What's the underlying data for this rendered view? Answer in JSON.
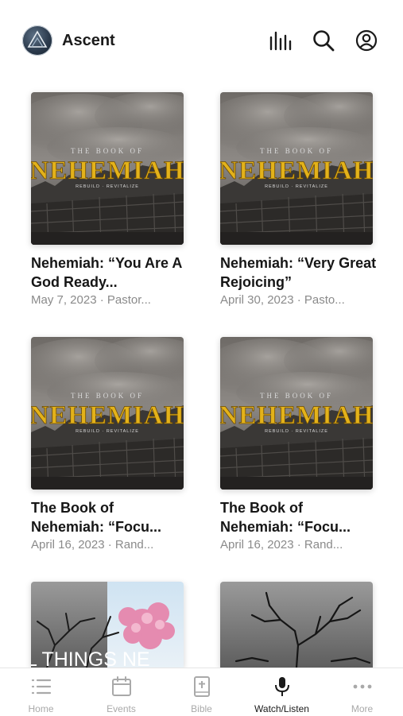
{
  "header": {
    "app_title": "Ascent",
    "icons": [
      "logo-icon",
      "audio-bars-icon",
      "search-icon",
      "account-icon"
    ]
  },
  "cards": [
    {
      "title": "Nehemiah: “You Are A God Ready...",
      "meta": "May 7, 2023 · Pastor...",
      "art_kicker": "THE BOOK OF",
      "art_title": "NEHEMIAH",
      "art_tagline": "REBUILD · REVITALIZE"
    },
    {
      "title": "Nehemiah: “Very Great Rejoicing”",
      "meta": "April 30, 2023 · Pasto...",
      "art_kicker": "THE BOOK OF",
      "art_title": "NEHEMIAH",
      "art_tagline": "REBUILD · REVITALIZE"
    },
    {
      "title": "The Book of Nehemiah: “Focu...",
      "meta": "April 16, 2023 · Rand...",
      "art_kicker": "THE BOOK OF",
      "art_title": "NEHEMIAH",
      "art_tagline": "REBUILD · REVITALIZE"
    },
    {
      "title": "The Book of Nehemiah: “Focu...",
      "meta": "April 16, 2023 · Rand...",
      "art_kicker": "THE BOOK OF",
      "art_title": "NEHEMIAH",
      "art_tagline": "REBUILD · REVITALIZE"
    }
  ],
  "partial_cards": [
    {
      "art_text": "L THINGS NE"
    },
    {
      "art_text": ""
    }
  ],
  "tabbar": {
    "items": [
      {
        "label": "Home",
        "icon": "list-icon",
        "active": false
      },
      {
        "label": "Events",
        "icon": "calendar-icon",
        "active": false
      },
      {
        "label": "Bible",
        "icon": "bible-icon",
        "active": false
      },
      {
        "label": "Watch/Listen",
        "icon": "microphone-icon",
        "active": true
      },
      {
        "label": "More",
        "icon": "more-dots-icon",
        "active": false
      }
    ]
  },
  "colors": {
    "accent_gold": "#e3b21a",
    "inactive_tab": "#a9a9a9",
    "active_tab": "#1a1a1a"
  }
}
